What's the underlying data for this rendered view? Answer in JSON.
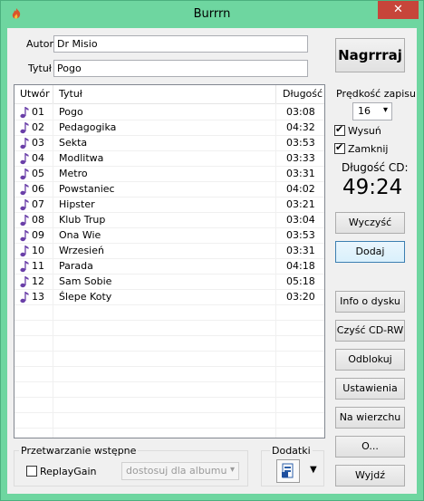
{
  "window": {
    "title": "Burrrn",
    "close_glyph": "✕"
  },
  "fields": {
    "author_label": "Autor",
    "author_value": "Dr Misio",
    "title_label": "Tytuł",
    "title_value": "Pogo"
  },
  "tracklist": {
    "columns": [
      "Utwór",
      "Tytuł",
      "Długość"
    ],
    "rows": [
      {
        "num": "01",
        "title": "Pogo",
        "length": "03:08"
      },
      {
        "num": "02",
        "title": "Pedagogika",
        "length": "04:32"
      },
      {
        "num": "03",
        "title": "Sekta",
        "length": "03:53"
      },
      {
        "num": "04",
        "title": "Modlitwa",
        "length": "03:33"
      },
      {
        "num": "05",
        "title": "Metro",
        "length": "03:31"
      },
      {
        "num": "06",
        "title": "Powstaniec",
        "length": "04:02"
      },
      {
        "num": "07",
        "title": "Hipster",
        "length": "03:21"
      },
      {
        "num": "08",
        "title": "Klub Trup",
        "length": "03:04"
      },
      {
        "num": "09",
        "title": "Ona Wie",
        "length": "03:53"
      },
      {
        "num": "10",
        "title": "Wrzesień",
        "length": "03:31"
      },
      {
        "num": "11",
        "title": "Parada",
        "length": "04:18"
      },
      {
        "num": "12",
        "title": "Sam Sobie",
        "length": "05:18"
      },
      {
        "num": "13",
        "title": "Ślepe Koty",
        "length": "03:20"
      }
    ]
  },
  "right": {
    "burn_label": "Nagrrraj",
    "speed_label": "Prędkość zapisu",
    "speed_value": "16",
    "eject_label": "Wysuń",
    "eject_checked": true,
    "close_label": "Zamknij",
    "close_checked": true,
    "cd_length_label": "Długość CD:",
    "cd_length_value": "49:24",
    "clear_label": "Wyczyść",
    "add_label": "Dodaj",
    "disc_info_label": "Info o dysku",
    "erase_label": "Czyść CD-RW",
    "unlock_label": "Odblokuj",
    "settings_label": "Ustawienia",
    "ontop_label": "Na wierzchu",
    "about_label": "O...",
    "exit_label": "Wyjdź"
  },
  "preprocess": {
    "group_label": "Przetwarzanie wstępne",
    "replaygain_label": "ReplayGain",
    "replaygain_checked": false,
    "mode_value": "dostosuj dla albumu"
  },
  "addons": {
    "group_label": "Dodatki"
  },
  "colors": {
    "frame": "#6ed6a0",
    "close": "#c7453a",
    "note": "#6a3fa8"
  }
}
